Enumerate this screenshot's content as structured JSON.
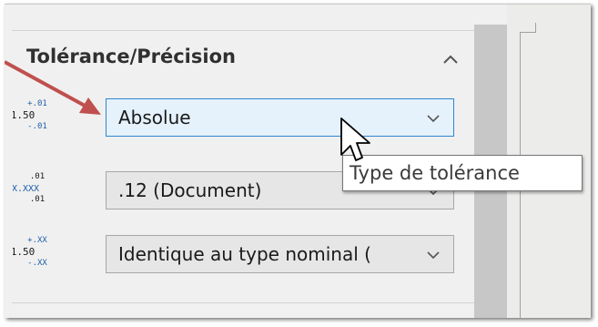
{
  "panel": {
    "title": "Tolérance/Précision",
    "collapse_icon": "chevron-up-icon"
  },
  "rows": [
    {
      "icon": "tolerance-type-icon",
      "icon_text": {
        "top": "+.01",
        "main": "1.50",
        "bottom": "-.01"
      },
      "value": "Absolue",
      "active": true
    },
    {
      "icon": "primary-precision-icon",
      "icon_text": {
        "top": ".01",
        "main": "X.XXX",
        "bottom": ".01"
      },
      "value": ".12 (Document)",
      "active": false
    },
    {
      "icon": "tolerance-precision-icon",
      "icon_text": {
        "top": "+.XX",
        "main": "1.50",
        "bottom": "-.XX"
      },
      "value": "Identique au type nominal (",
      "active": false
    }
  ],
  "tooltip": {
    "text": "Type de tolérance"
  },
  "colors": {
    "accent": "#2e86d1",
    "active_field": "#e5f1fb",
    "callout": "#c0504d",
    "icon_blue": "#1f5fa8"
  }
}
